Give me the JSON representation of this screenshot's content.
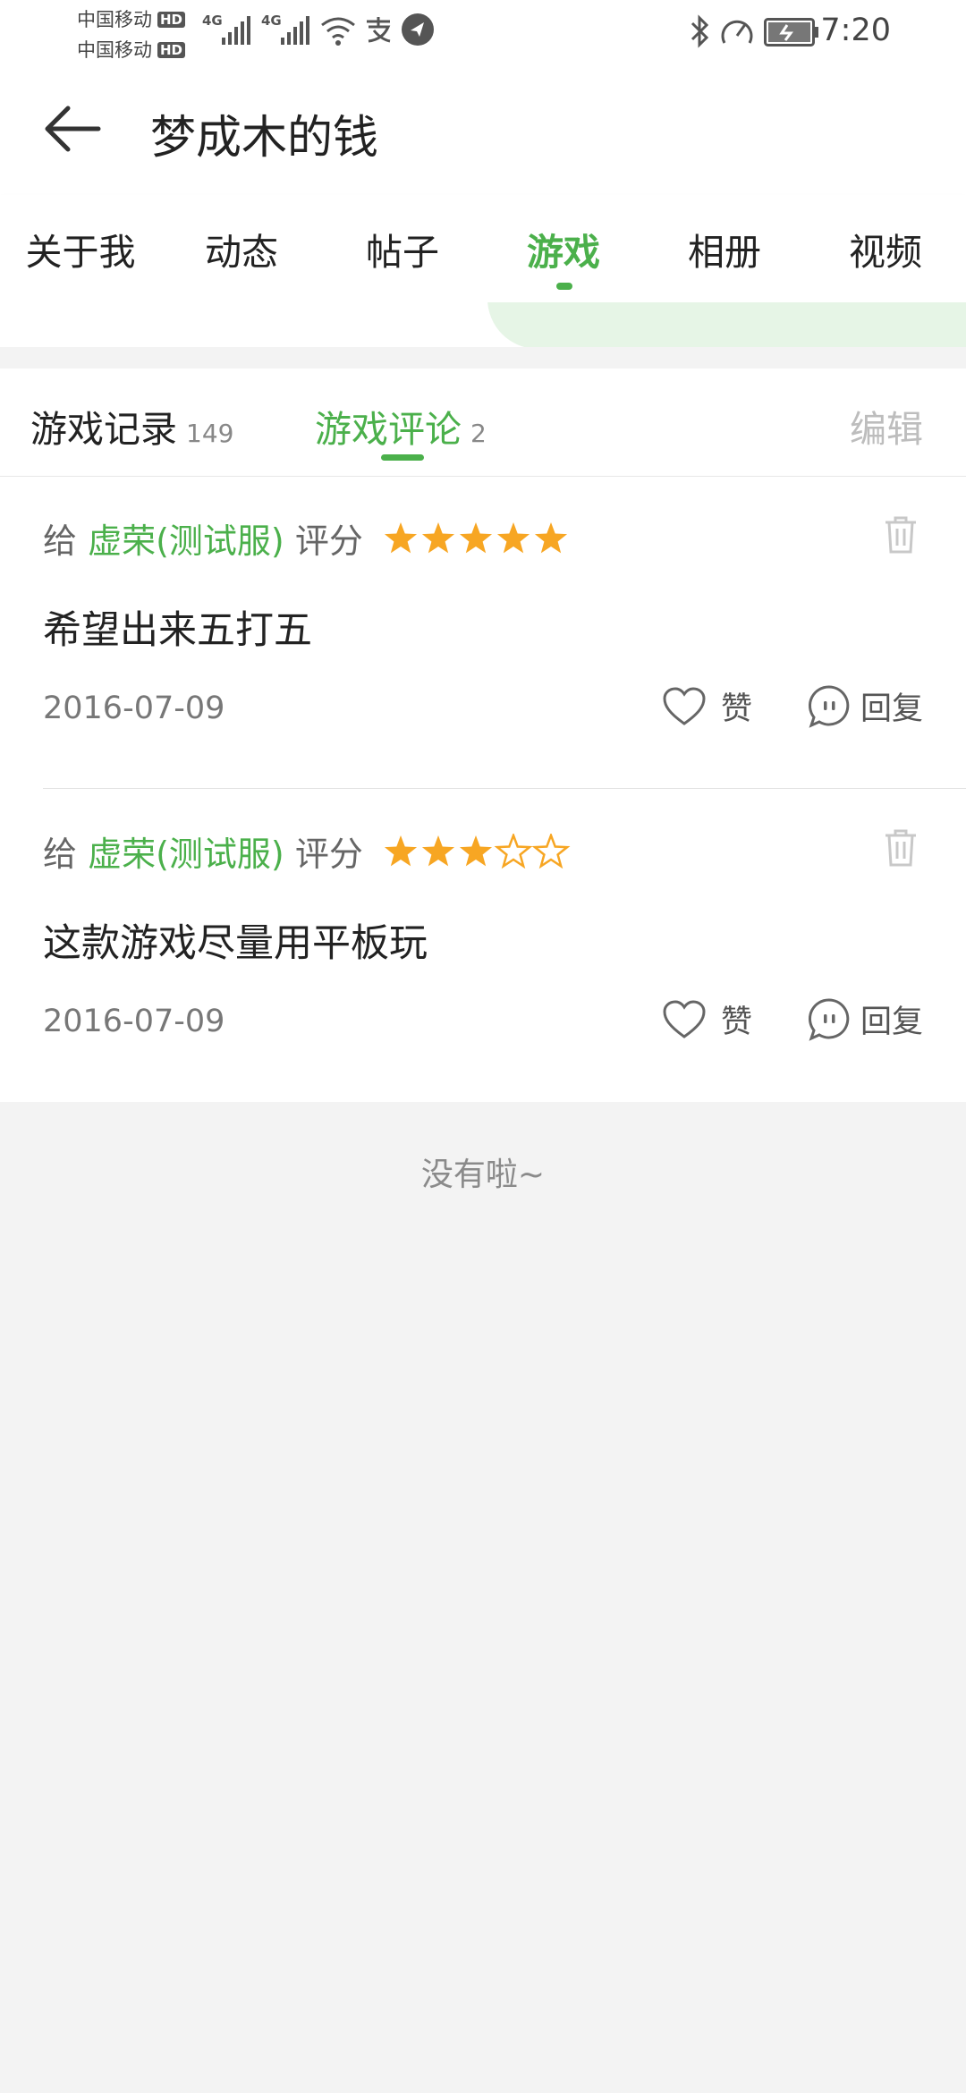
{
  "status_bar": {
    "carrier1": "中国移动",
    "carrier2": "中国移动",
    "hd": "HD",
    "net1": "4G",
    "net2": "4G",
    "time": "7:20"
  },
  "header": {
    "title": "梦成木的钱"
  },
  "tabs": [
    {
      "label": "关于我"
    },
    {
      "label": "动态"
    },
    {
      "label": "帖子"
    },
    {
      "label": "游戏"
    },
    {
      "label": "相册"
    },
    {
      "label": "视频"
    }
  ],
  "active_tab": "游戏",
  "subtabs": {
    "records_label": "游戏记录",
    "records_count": "149",
    "reviews_label": "游戏评论",
    "reviews_count": "2",
    "edit_label": "编辑"
  },
  "reviews": [
    {
      "prefix": "给",
      "game": "虚荣(测试服)",
      "rating_label": "评分",
      "rating": 5,
      "text": "希望出来五打五",
      "date": "2016-07-09",
      "like_label": "赞",
      "reply_label": "回复"
    },
    {
      "prefix": "给",
      "game": "虚荣(测试服)",
      "rating_label": "评分",
      "rating": 3,
      "text": "这款游戏尽量用平板玩",
      "date": "2016-07-09",
      "like_label": "赞",
      "reply_label": "回复"
    }
  ],
  "footer": {
    "no_more": "没有啦~"
  },
  "colors": {
    "accent": "#4bb04b",
    "star": "#f7a623"
  }
}
